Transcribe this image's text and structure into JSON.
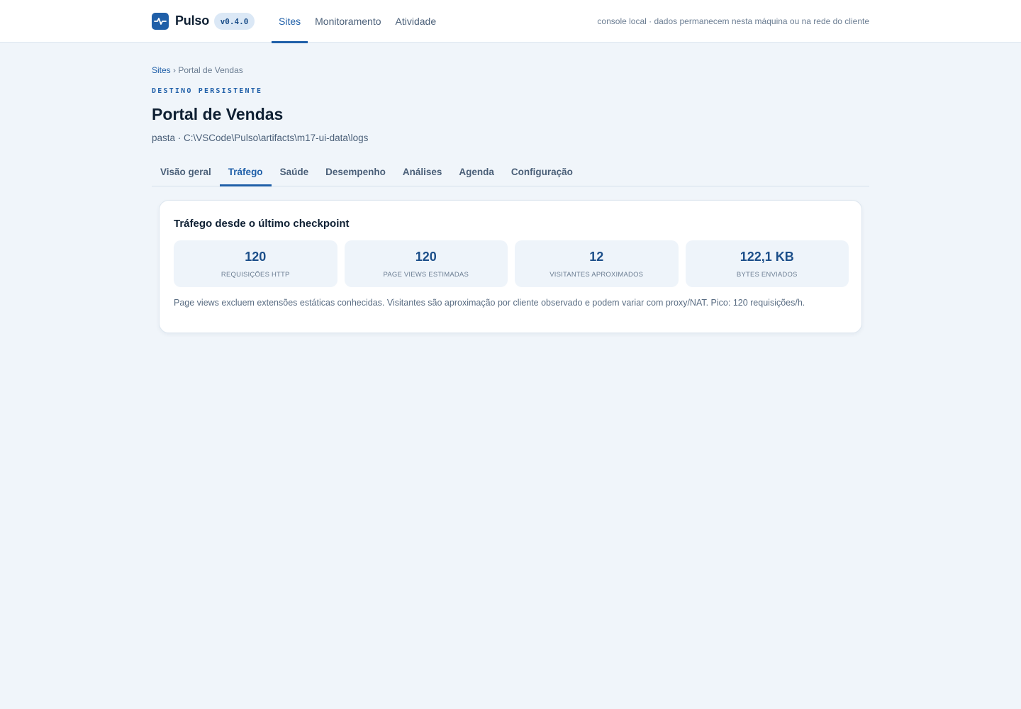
{
  "app": {
    "brand": "Pulso",
    "version": "v0.4.0",
    "nav": [
      {
        "label": "Sites",
        "active": true
      },
      {
        "label": "Monitoramento",
        "active": false
      },
      {
        "label": "Atividade",
        "active": false
      }
    ],
    "top_note": "console local · dados permanecem nesta máquina ou na rede do cliente",
    "accent_color": "#1f5fa8",
    "logo_icon": "pulse-icon"
  },
  "breadcrumb": {
    "root": "Sites",
    "separator": "›",
    "current": "Portal de Vendas"
  },
  "header": {
    "eyebrow": "DESTINO PERSISTENTE",
    "title": "Portal de Vendas",
    "subtitle": "pasta · C:\\VSCode\\Pulso\\artifacts\\m17-ui-data\\logs"
  },
  "tabs": [
    {
      "label": "Visão geral",
      "active": false
    },
    {
      "label": "Tráfego",
      "active": true
    },
    {
      "label": "Saúde",
      "active": false
    },
    {
      "label": "Desempenho",
      "active": false
    },
    {
      "label": "Análises",
      "active": false
    },
    {
      "label": "Agenda",
      "active": false
    },
    {
      "label": "Configuração",
      "active": false
    }
  ],
  "traffic": {
    "title": "Tráfego desde o último checkpoint",
    "stats": [
      {
        "value": "120",
        "label": "Requisições HTTP"
      },
      {
        "value": "120",
        "label": "Page views estimadas"
      },
      {
        "value": "12",
        "label": "Visitantes aproximados"
      },
      {
        "value": "122,1 KB",
        "label": "Bytes enviados"
      }
    ],
    "note": "Page views excluem extensões estáticas conhecidas. Visitantes são aproximação por cliente observado e podem variar com proxy/NAT. Pico: 120 requisições/h."
  }
}
